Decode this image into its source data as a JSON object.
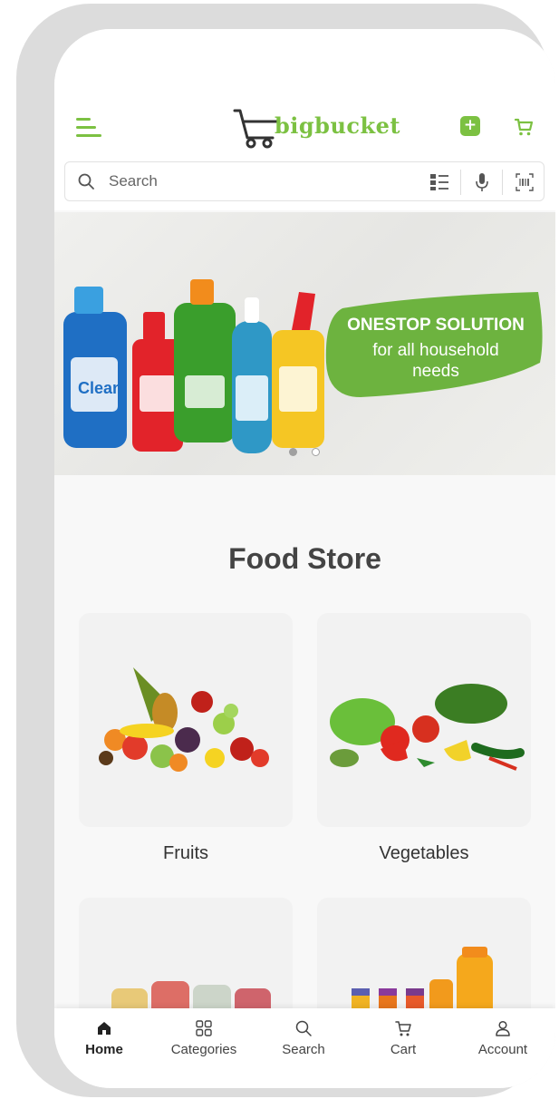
{
  "header": {
    "logo_text": "bigbucket",
    "add_label": "+"
  },
  "search": {
    "placeholder": "Search"
  },
  "banner": {
    "title": "ONESTOP SOLUTION",
    "subtitle_line1": "for all household",
    "subtitle_line2": "needs",
    "slides_total": 2,
    "active_slide": 1
  },
  "food_store": {
    "title": "Food Store",
    "categories": [
      {
        "label": "Fruits"
      },
      {
        "label": "Vegetables"
      },
      {
        "label": ""
      },
      {
        "label": ""
      }
    ]
  },
  "bottom_nav": {
    "items": [
      {
        "label": "Home",
        "icon": "home-icon",
        "active": true
      },
      {
        "label": "Categories",
        "icon": "grid-icon",
        "active": false
      },
      {
        "label": "Search",
        "icon": "search-icon",
        "active": false
      },
      {
        "label": "Cart",
        "icon": "cart-icon",
        "active": false
      },
      {
        "label": "Account",
        "icon": "user-icon",
        "active": false
      }
    ]
  },
  "colors": {
    "accent": "#7cc142",
    "text": "#444444"
  }
}
